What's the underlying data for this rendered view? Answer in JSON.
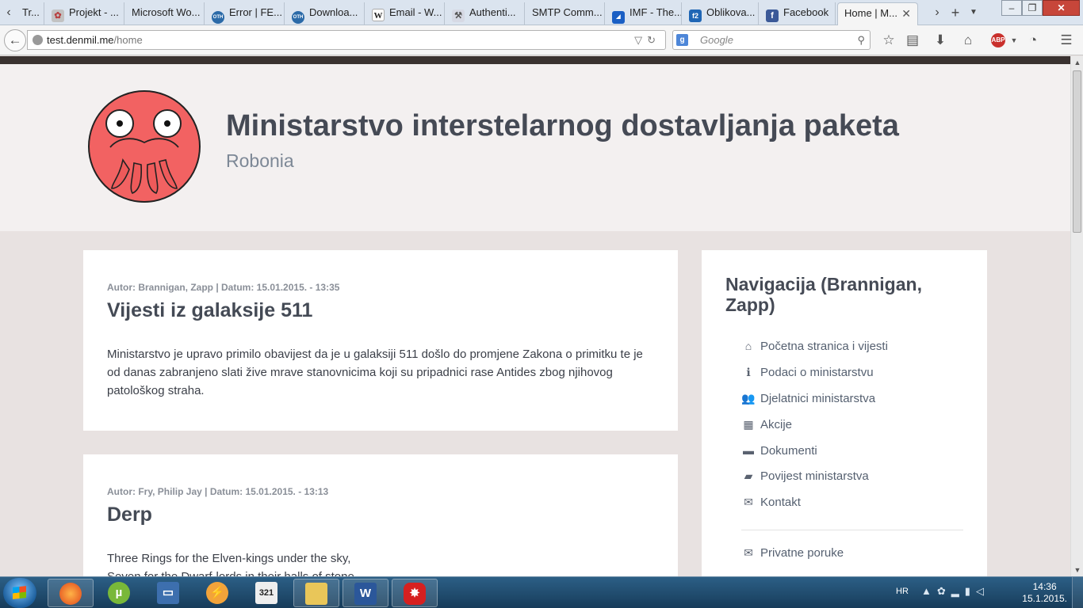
{
  "browser": {
    "tabs": [
      {
        "label": "Tr...",
        "favicon": "tr",
        "color": "#444"
      },
      {
        "label": "Projekt - ...",
        "favicon": "gear",
        "color": "#b84040"
      },
      {
        "label": "Microsoft Wo...",
        "favicon": "",
        "color": ""
      },
      {
        "label": "Error | FE...",
        "favicon": "OTH",
        "color": "#2b6aa8"
      },
      {
        "label": "Downloa...",
        "favicon": "OTH",
        "color": "#2b6aa8"
      },
      {
        "label": "Email - W...",
        "favicon": "W",
        "color": "#777"
      },
      {
        "label": "Authenti...",
        "favicon": "wrench",
        "color": "#8a8a9a"
      },
      {
        "label": "SMTP Comm...",
        "favicon": "",
        "color": ""
      },
      {
        "label": "IMF - The...",
        "favicon": "IMF",
        "color": "#1a5fc4"
      },
      {
        "label": "Oblikova...",
        "favicon": "f2",
        "color": "#1f66b5"
      },
      {
        "label": "Facebook",
        "favicon": "f",
        "color": "#3b5998"
      },
      {
        "label": "Home | M...",
        "favicon": "",
        "color": ""
      }
    ],
    "url_host": "test.denmil.me",
    "url_path": "/home",
    "search_placeholder": "Google",
    "search_engine_badge": "g"
  },
  "site": {
    "title": "Ministarstvo interstelarnog dostavljanja paketa",
    "subtitle": "Robonia"
  },
  "posts": [
    {
      "meta": "Autor: Brannigan, Zapp | Datum: 15.01.2015. - 13:35",
      "title": "Vijesti iz galaksije 511",
      "body": "Ministarstvo je upravo primilo obavijest da je u galaksiji 511 došlo do promjene Zakona o primitku te je od danas zabranjeno slati žive mrave stanovnicima koji su pripadnici rase Antides zbog njihovog patološkog straha."
    },
    {
      "meta": "Autor: Fry, Philip Jay | Datum: 15.01.2015. - 13:13",
      "title": "Derp",
      "body_line1": "Three Rings for the Elven-kings under the sky,",
      "body_line2": "Seven for the Dwarf-lords in their halls of stone,"
    }
  ],
  "sidebar": {
    "title": "Navigacija (Brannigan, Zapp)",
    "items": [
      {
        "label": "Početna stranica i vijesti",
        "icon": "home-icon",
        "glyph": "⌂"
      },
      {
        "label": "Podaci o ministarstvu",
        "icon": "info-icon",
        "glyph": "ℹ"
      },
      {
        "label": "Djelatnici ministarstva",
        "icon": "users-icon",
        "glyph": "👥"
      },
      {
        "label": "Akcije",
        "icon": "calendar-icon",
        "glyph": "▦"
      },
      {
        "label": "Dokumenti",
        "icon": "folder-icon",
        "glyph": "▬"
      },
      {
        "label": "Povijest ministarstva",
        "icon": "book-icon",
        "glyph": "▰"
      },
      {
        "label": "Kontakt",
        "icon": "envelope-icon",
        "glyph": "✉"
      }
    ],
    "secondary": [
      {
        "label": "Privatne poruke",
        "icon": "envelope-open-icon",
        "glyph": "✉"
      }
    ]
  },
  "taskbar": {
    "language": "HR",
    "time": "14:36",
    "date": "15.1.2015."
  }
}
